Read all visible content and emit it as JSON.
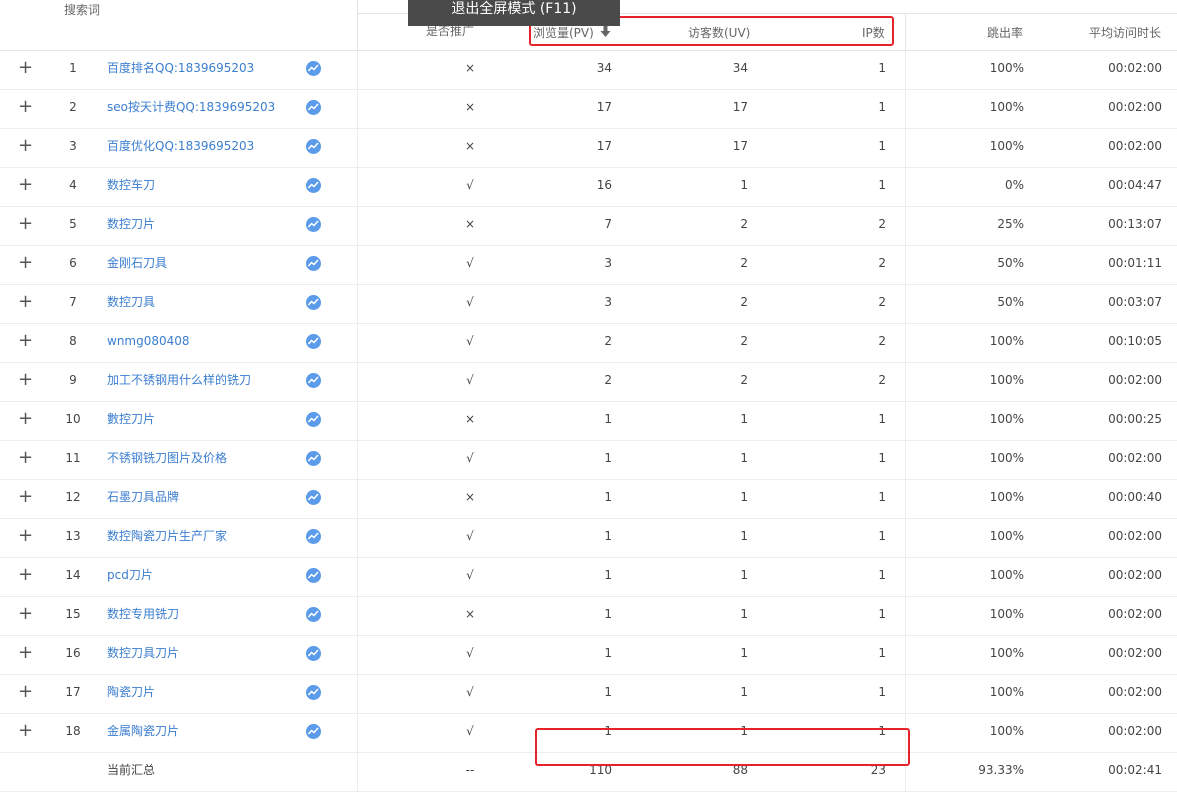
{
  "banner": "退出全屏模式 (F11)",
  "header": {
    "keyword": "搜索词",
    "promoted": "是否推广",
    "pv": "浏览量(PV)",
    "uv": "访客数(UV)",
    "ip": "IP数",
    "bounce": "跳出率",
    "duration": "平均访问时长",
    "sort_icon": "arrow-down-icon"
  },
  "rows": [
    {
      "idx": "1",
      "keyword": "百度排名QQ:1839695203",
      "promoted": "×",
      "pv": "34",
      "uv": "34",
      "ip": "1",
      "bounce": "100%",
      "duration": "00:02:00"
    },
    {
      "idx": "2",
      "keyword": "seo按天计费QQ:1839695203",
      "promoted": "×",
      "pv": "17",
      "uv": "17",
      "ip": "1",
      "bounce": "100%",
      "duration": "00:02:00"
    },
    {
      "idx": "3",
      "keyword": "百度优化QQ:1839695203",
      "promoted": "×",
      "pv": "17",
      "uv": "17",
      "ip": "1",
      "bounce": "100%",
      "duration": "00:02:00"
    },
    {
      "idx": "4",
      "keyword": "数控车刀",
      "promoted": "√",
      "pv": "16",
      "uv": "1",
      "ip": "1",
      "bounce": "0%",
      "duration": "00:04:47"
    },
    {
      "idx": "5",
      "keyword": "数控刀片",
      "promoted": "×",
      "pv": "7",
      "uv": "2",
      "ip": "2",
      "bounce": "25%",
      "duration": "00:13:07"
    },
    {
      "idx": "6",
      "keyword": "金刚石刀具",
      "promoted": "√",
      "pv": "3",
      "uv": "2",
      "ip": "2",
      "bounce": "50%",
      "duration": "00:01:11"
    },
    {
      "idx": "7",
      "keyword": "数控刀具",
      "promoted": "√",
      "pv": "3",
      "uv": "2",
      "ip": "2",
      "bounce": "50%",
      "duration": "00:03:07"
    },
    {
      "idx": "8",
      "keyword": "wnmg080408",
      "promoted": "√",
      "pv": "2",
      "uv": "2",
      "ip": "2",
      "bounce": "100%",
      "duration": "00:10:05"
    },
    {
      "idx": "9",
      "keyword": "加工不锈钢用什么样的铣刀",
      "promoted": "√",
      "pv": "2",
      "uv": "2",
      "ip": "2",
      "bounce": "100%",
      "duration": "00:02:00"
    },
    {
      "idx": "10",
      "keyword": "數控刀片",
      "promoted": "×",
      "pv": "1",
      "uv": "1",
      "ip": "1",
      "bounce": "100%",
      "duration": "00:00:25"
    },
    {
      "idx": "11",
      "keyword": "不锈钢铣刀图片及价格",
      "promoted": "√",
      "pv": "1",
      "uv": "1",
      "ip": "1",
      "bounce": "100%",
      "duration": "00:02:00"
    },
    {
      "idx": "12",
      "keyword": "石墨刀具品牌",
      "promoted": "×",
      "pv": "1",
      "uv": "1",
      "ip": "1",
      "bounce": "100%",
      "duration": "00:00:40"
    },
    {
      "idx": "13",
      "keyword": "数控陶瓷刀片生产厂家",
      "promoted": "√",
      "pv": "1",
      "uv": "1",
      "ip": "1",
      "bounce": "100%",
      "duration": "00:02:00"
    },
    {
      "idx": "14",
      "keyword": "pcd刀片",
      "promoted": "√",
      "pv": "1",
      "uv": "1",
      "ip": "1",
      "bounce": "100%",
      "duration": "00:02:00"
    },
    {
      "idx": "15",
      "keyword": "数控专用铣刀",
      "promoted": "×",
      "pv": "1",
      "uv": "1",
      "ip": "1",
      "bounce": "100%",
      "duration": "00:02:00"
    },
    {
      "idx": "16",
      "keyword": "数控刀具刀片",
      "promoted": "√",
      "pv": "1",
      "uv": "1",
      "ip": "1",
      "bounce": "100%",
      "duration": "00:02:00"
    },
    {
      "idx": "17",
      "keyword": "陶瓷刀片",
      "promoted": "√",
      "pv": "1",
      "uv": "1",
      "ip": "1",
      "bounce": "100%",
      "duration": "00:02:00"
    },
    {
      "idx": "18",
      "keyword": "金属陶瓷刀片",
      "promoted": "√",
      "pv": "1",
      "uv": "1",
      "ip": "1",
      "bounce": "100%",
      "duration": "00:02:00"
    }
  ],
  "total": {
    "label": "当前汇总",
    "promoted": "--",
    "pv": "110",
    "uv": "88",
    "ip": "23",
    "bounce": "93.33%",
    "duration": "00:02:41"
  },
  "colors": {
    "link": "#3b7ecf",
    "highlight": "#e6232a",
    "accent": "#3a8de0"
  }
}
